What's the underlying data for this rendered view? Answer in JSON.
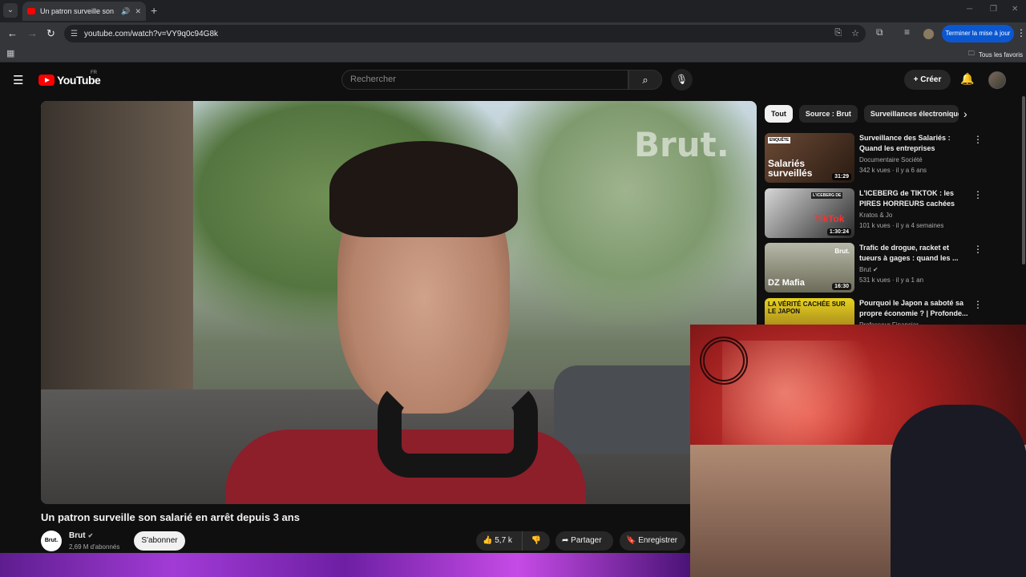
{
  "browser": {
    "tab_title": "Un patron surveille son salarié",
    "url": "youtube.com/watch?v=VY9q0c94G8k",
    "update_label": "Terminer la mise à jour",
    "bookmarks_folder": "Tous les favoris"
  },
  "header": {
    "logo_text": "YouTube",
    "region": "FR",
    "search_placeholder": "Rechercher",
    "create_label": "Créer"
  },
  "video": {
    "watermark": "Brut.",
    "title": "Un patron surveille son salarié en arrêt depuis 3 ans",
    "channel_logo": "Brut.",
    "channel": "Brut",
    "subscribers": "2,69 M d'abonnés",
    "subscribe_label": "S'abonner",
    "likes": "5,7 k",
    "share_label": "Partager",
    "save_label": "Enregistrer"
  },
  "chips": [
    "Tout",
    "Source : Brut",
    "Surveillances électronique"
  ],
  "recommendations": [
    {
      "title": "Surveillance des Salariés : Quand les entreprises utilisent...",
      "channel": "Documentaire Société",
      "meta": "342 k vues · il y a 6 ans",
      "duration": "31:29",
      "thumb_label": "ENQUÊTE",
      "thumb_text": "Salariés surveillés"
    },
    {
      "title": "L'ICEBERG de TIKTOK : les PIRES HORREURS cachées de...",
      "channel": "Kratos & Jo",
      "meta": "101 k vues · il y a 4 semaines",
      "duration": "1:30:24",
      "thumb_label": "L'ICEBERG DE",
      "thumb_text": "TikTok"
    },
    {
      "title": "Trafic de drogue, racket et tueurs à gages : quand les ...",
      "channel": "Brut",
      "meta": "531 k vues · il y a 1 an",
      "duration": "16:30",
      "thumb_label": "Brut.",
      "thumb_text": "DZ Mafia"
    },
    {
      "title": "Pourquoi le Japon a saboté sa propre économie ? | Profonde...",
      "channel": "Professeur Financier",
      "meta": "",
      "duration": "",
      "thumb_label": "",
      "thumb_text": "LA VÉRITÉ CACHÉE SUR LE JAPON"
    }
  ]
}
